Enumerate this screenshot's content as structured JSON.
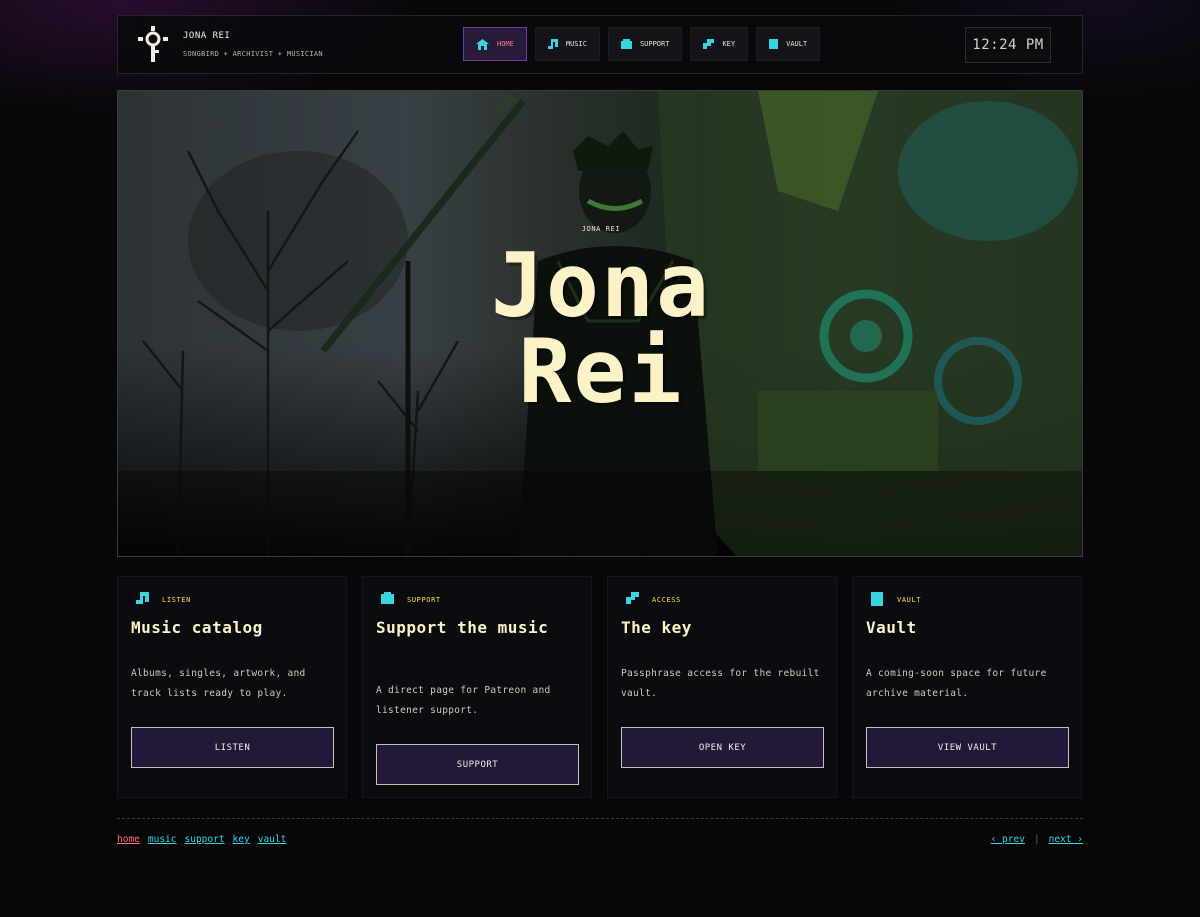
{
  "header": {
    "brand_name": "JONA REI",
    "brand_sub": "SONGBIRD + ARCHIVIST + MUSICIAN",
    "nav": [
      {
        "label": "HOME",
        "icon": "home-icon",
        "active": true
      },
      {
        "label": "MUSIC",
        "icon": "music-note-icon",
        "active": false
      },
      {
        "label": "SUPPORT",
        "icon": "support-icon",
        "active": false
      },
      {
        "label": "KEY",
        "icon": "key-icon",
        "active": false
      },
      {
        "label": "VAULT",
        "icon": "vault-icon",
        "active": false
      }
    ],
    "clock": "12:24 PM"
  },
  "hero": {
    "eyebrow": "JONA REI",
    "title_line1": "Jona",
    "title_line2": "Rei"
  },
  "cards": [
    {
      "eyebrow": "LISTEN",
      "icon": "music-note-icon",
      "title": "Music catalog",
      "desc": "Albums, singles, artwork, and track lists ready to play.",
      "button": "LISTEN"
    },
    {
      "eyebrow": "SUPPORT",
      "icon": "support-icon",
      "title": "Support the music",
      "desc": "A direct page for Patreon and listener support.",
      "button": "SUPPORT"
    },
    {
      "eyebrow": "ACCESS",
      "icon": "key-icon",
      "title": "The key",
      "desc": "Passphrase access for the rebuilt vault.",
      "button": "OPEN KEY"
    },
    {
      "eyebrow": "VAULT",
      "icon": "vault-icon",
      "title": "Vault",
      "desc": "A coming-soon space for future archive material.",
      "button": "VIEW VAULT"
    }
  ],
  "footer": {
    "links": [
      "home",
      "music",
      "support",
      "key",
      "vault"
    ],
    "prev": "‹ prev",
    "sep": "|",
    "next": "next ›"
  },
  "colors": {
    "accent_cyan": "#38d5e0",
    "accent_yellow": "#f4e14a",
    "accent_pink": "#ff6f7f",
    "cream": "#fbf3c7",
    "button_bg": "#231839"
  }
}
